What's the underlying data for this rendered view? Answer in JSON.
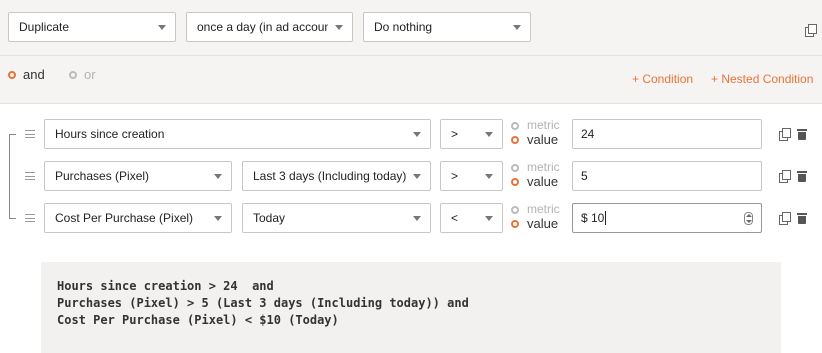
{
  "top": {
    "action": "Duplicate",
    "frequency": "once a day (in ad account t",
    "otherwise": "Do nothing"
  },
  "logic": {
    "and_label": "and",
    "or_label": "or",
    "selected": "and",
    "add_condition": "+ Condition",
    "add_nested": "+ Nested Condition"
  },
  "conditions": [
    {
      "field": "Hours since creation",
      "period": "",
      "operator": ">",
      "type_metric": "metric",
      "type_value": "value",
      "value": "24"
    },
    {
      "field": "Purchases (Pixel)",
      "period": "Last 3 days (Including today)",
      "operator": ">",
      "type_metric": "metric",
      "type_value": "value",
      "value": "5"
    },
    {
      "field": "Cost Per Purchase (Pixel)",
      "period": "Today",
      "operator": "<",
      "type_metric": "metric",
      "type_value": "value",
      "value": "$ 10"
    }
  ],
  "summary": {
    "line1": "Hours since creation > 24  and",
    "line2": "Purchases (Pixel) > 5 (Last 3 days (Including today)) and",
    "line3": "Cost Per Purchase (Pixel) < $10 (Today)"
  },
  "icons": {
    "copy": "copy-icon",
    "delete": "trash-icon",
    "drag": "drag-handle-icon"
  },
  "colors": {
    "accent": "#e8733a",
    "panel": "#f5f4f2",
    "code_bg": "#f2f1ef"
  }
}
